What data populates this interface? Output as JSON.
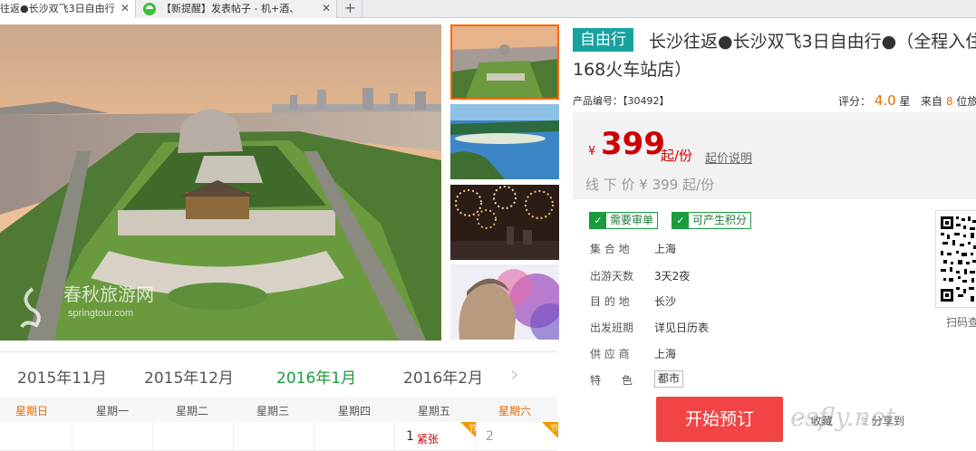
{
  "browser": {
    "tabs": [
      {
        "title": "往返●长沙双飞3日自由行",
        "close": "✕"
      },
      {
        "title": "【新提醒】发表帖子 - 机+酒、",
        "close": "✕"
      }
    ],
    "new_tab": "+"
  },
  "gallery": {
    "main_watermark": "春秋旅游网",
    "main_watermark_url": "springtour.com"
  },
  "calendar": {
    "months": [
      "2015年11月",
      "2015年12月",
      "2016年1月",
      "2016年2月"
    ],
    "next": "›",
    "weekdays": [
      "星期日",
      "星期一",
      "星期二",
      "星期三",
      "星期四",
      "星期五",
      "星期六"
    ],
    "first_row": [
      {
        "day": "1",
        "status": "紧张",
        "corner": "节"
      },
      {
        "day": "2",
        "status": "",
        "corner": "节"
      }
    ]
  },
  "product": {
    "type_tag": "自由行",
    "title_line1": "长沙往返●长沙双飞3日自由行●（全程入住",
    "title_line2": "168火车站店）",
    "product_no_label": "产品编号：",
    "product_no": "【30492】",
    "rating_label": "评分：",
    "rating_value": "4.0",
    "rating_unit": "星",
    "reviews_prefix": "来自",
    "reviews_count": "8",
    "reviews_suffix": "位旅",
    "price_currency": "¥",
    "price": "399",
    "price_unit": "起/份",
    "price_note": "起价说明",
    "offline_price": "线 下 价  ¥ 399 起/份",
    "badges": [
      "需要审单",
      "可产生积分"
    ],
    "badge_check": "✓",
    "info": [
      {
        "label": "集 合 地",
        "value": "上海"
      },
      {
        "label": "出游天数",
        "value": "3天2夜"
      },
      {
        "label": "目 的 地",
        "value": "长沙"
      },
      {
        "label": "出发班期",
        "value": "详见日历表"
      },
      {
        "label": "供 应 商",
        "value": "上海"
      },
      {
        "label": "特      色",
        "value": "都市"
      }
    ],
    "qr_caption": "扫码查",
    "book_button": "开始预订",
    "favorite": "收藏",
    "share": "分享到"
  },
  "watermark": "esfly.net",
  "colors": {
    "accent_green": "#1a9b3e",
    "price_red": "#cc0000",
    "orange": "#e56b00",
    "book_red": "#f24444",
    "teal_tag": "#17a2a0"
  }
}
